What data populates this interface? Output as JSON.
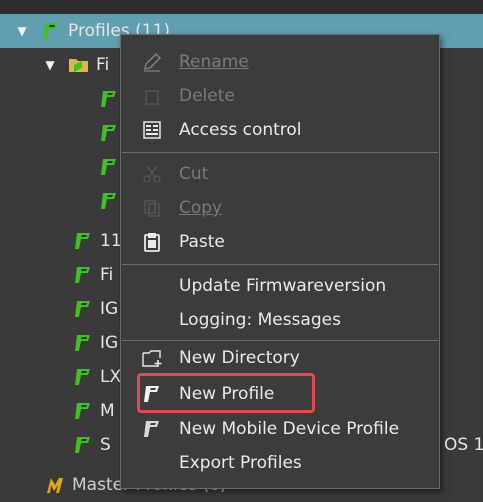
{
  "tree": {
    "profiles_label": "Profiles (11)",
    "folder_label_partial": "Fi",
    "row_labels": [
      "11",
      "Fi",
      "IG",
      "IG",
      "LX",
      "M",
      "S"
    ],
    "right_edge_text": "OS 1",
    "master_label": "Master Profiles (6)"
  },
  "menu": {
    "rename": "Rename",
    "delete": "Delete",
    "access_control": "Access control",
    "cut": "Cut",
    "copy": "Copy",
    "paste": "Paste",
    "update_firmware": "Update Firmwareversion",
    "logging_messages": "Logging: Messages",
    "new_directory": "New Directory",
    "new_profile": "New Profile",
    "new_mobile_profile": "New Mobile Device Profile",
    "export_profiles": "Export Profiles"
  },
  "colors": {
    "selection": "#5f9fb0",
    "profile_icon_green": "#3ec21f",
    "master_icon_orange": "#e8a21a",
    "highlight_red": "#e0494d",
    "disabled_text": "#7a7a7a"
  }
}
